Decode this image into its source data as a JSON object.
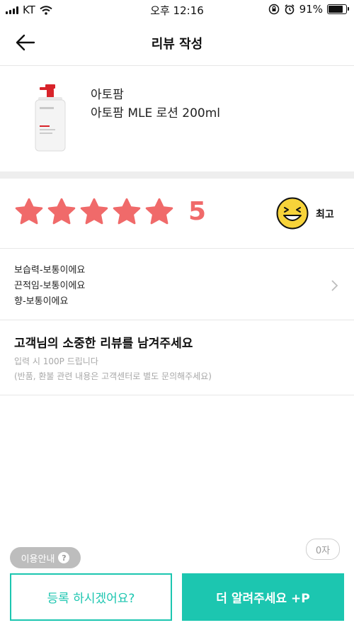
{
  "status_bar": {
    "carrier": "KT",
    "time": "오후 12:16",
    "battery": "91%",
    "battery_level": 0.91,
    "icons": [
      "signal-icon",
      "wifi-icon",
      "lock-rotation-icon",
      "alarm-icon",
      "battery-icon"
    ]
  },
  "header": {
    "title": "리뷰 작성",
    "back_icon": "arrow-left-icon"
  },
  "product": {
    "brand": "아토팜",
    "name": "아토팜 MLE 로션 200ml"
  },
  "rating": {
    "value": 5,
    "max": 5,
    "score_text": "5",
    "label": "최고",
    "star_color": "#f06a6a",
    "emoji_icon": "grinning-face-icon"
  },
  "attributes": {
    "lines": [
      "보습력-보통이에요",
      "끈적임-보통이에요",
      "향-보통이에요"
    ],
    "chevron_icon": "chevron-right-icon"
  },
  "review": {
    "prompt": "고객님의 소중한 리뷰를 남겨주세요",
    "hint1": "입력 시 100P 드립니다",
    "hint2": "(반품, 환불 관련 내용은 고객센터로 별도 문의해주세요)"
  },
  "counter": "0자",
  "usage": {
    "label": "이용안내",
    "icon_text": "?"
  },
  "buttons": {
    "register": "등록 하시겠어요?",
    "more": "더 알려주세요 +P"
  },
  "colors": {
    "accent": "#1cc6b0",
    "star": "#f06a6a",
    "emoji": "#f7d33a"
  }
}
